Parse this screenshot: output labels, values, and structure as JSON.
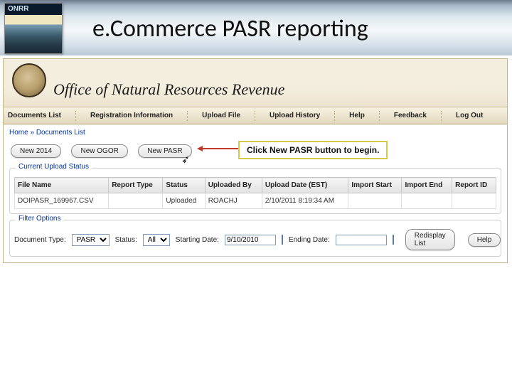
{
  "logo": {
    "label": "ONRR"
  },
  "slide_title": "e.Commerce PASR reporting",
  "app_header": "Office of Natural Resources Revenue",
  "menu": {
    "items": [
      "Documents List",
      "Registration Information",
      "Upload File",
      "Upload History",
      "Help",
      "Feedback",
      "Log Out"
    ]
  },
  "breadcrumb": {
    "home": "Home",
    "sep": "»",
    "current": "Documents List"
  },
  "toolbar": {
    "new_2014": "New 2014",
    "new_ogor": "New OGOR",
    "new_pasr": "New PASR"
  },
  "callout": "Click New PASR button to begin.",
  "upload_panel": {
    "title": "Current Upload Status",
    "columns": [
      "File Name",
      "Report Type",
      "Status",
      "Uploaded By",
      "Upload Date (EST)",
      "Import Start",
      "Import End",
      "Report ID"
    ],
    "rows": [
      {
        "file": "DOIPASR_169967.CSV",
        "type": "",
        "status": "Uploaded",
        "by": "ROACHJ",
        "date": "2/10/2011 8:19:34 AM",
        "istart": "",
        "iend": "",
        "rid": ""
      }
    ]
  },
  "filter_panel": {
    "title": "Filter Options",
    "doc_type_label": "Document Type:",
    "doc_type_value": "PASR",
    "status_label": "Status:",
    "status_value": "All",
    "start_label": "Starting Date:",
    "start_value": "9/10/2010",
    "end_label": "Ending Date:",
    "end_value": "",
    "redisplay": "Redisplay List",
    "help": "Help"
  }
}
